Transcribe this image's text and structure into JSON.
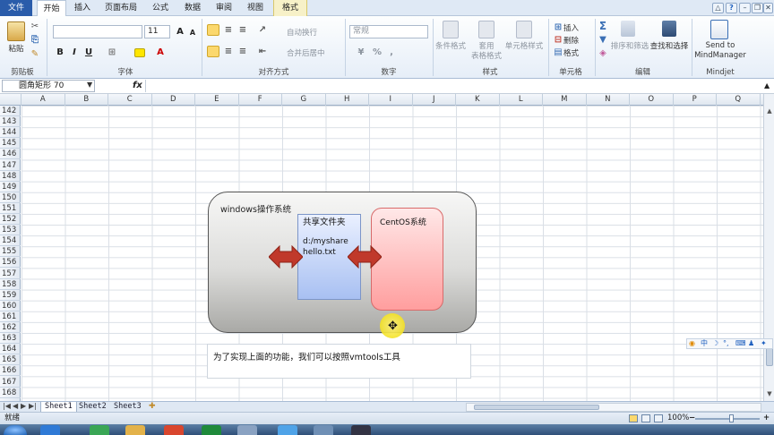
{
  "tabs": [
    "文件",
    "开始",
    "插入",
    "页面布局",
    "公式",
    "数据",
    "审阅",
    "视图",
    "格式"
  ],
  "ribbon": {
    "clipboard": {
      "paste": "粘贴",
      "label": "剪贴板"
    },
    "font": {
      "name": "",
      "size": "11",
      "bold": "B",
      "italic": "I",
      "underline": "U",
      "grow": "A",
      "shrink": "A",
      "label": "字体"
    },
    "alignment": {
      "wrap": "自动换行",
      "merge": "合并后居中",
      "label": "对齐方式"
    },
    "number": {
      "format": "常规",
      "percent": "%",
      "comma": ",",
      "label": "数字"
    },
    "styles": {
      "cond": "条件格式",
      "table1": "套用",
      "table2": "表格格式",
      "cell": "单元格样式",
      "label": "样式"
    },
    "cells": {
      "insert": "插入",
      "delete": "删除",
      "format": "格式",
      "label": "单元格"
    },
    "editing": {
      "sort": "排序和筛选",
      "find": "查找和选择",
      "label": "编辑"
    },
    "mindjet": {
      "send1": "Send to",
      "send2": "MindManager",
      "label": "Mindjet"
    }
  },
  "formula_bar": {
    "namebox": "圆角矩形 70",
    "fx": "fx",
    "content": ""
  },
  "columns": [
    "A",
    "B",
    "C",
    "D",
    "E",
    "F",
    "G",
    "H",
    "I",
    "J",
    "K",
    "L",
    "M",
    "N",
    "O",
    "P",
    "Q"
  ],
  "rows": [
    "142",
    "143",
    "144",
    "145",
    "146",
    "147",
    "148",
    "149",
    "150",
    "151",
    "152",
    "153",
    "154",
    "155",
    "156",
    "157",
    "158",
    "159",
    "160",
    "161",
    "162",
    "163",
    "164",
    "165",
    "166",
    "167",
    "168"
  ],
  "diagram": {
    "windows_label": "windows操作系统",
    "shared_title": "共享文件夹",
    "shared_path": "d:/myshare",
    "shared_file": "hello.txt",
    "centos_label": "CentOS系统",
    "caption": "为了实现上面的功能，我们可以按照vmtools工具"
  },
  "ime": {
    "chars": "中"
  },
  "sheets": [
    "Sheet1",
    "Sheet2",
    "Sheet3"
  ],
  "status": {
    "ready": "就绪",
    "zoom": "100%"
  },
  "colors": {
    "file_tab": "#2a5caa",
    "shared_fill": "#a8c0f2",
    "centos_fill": "#ff9e9e",
    "arrow": "#c0392b"
  }
}
